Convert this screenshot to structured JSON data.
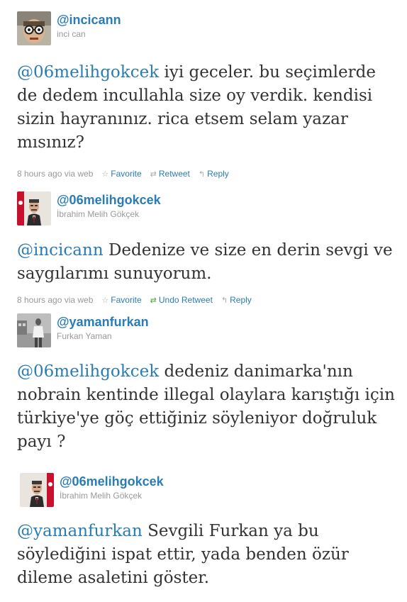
{
  "tweets": [
    {
      "handle": "@incicann",
      "name": "inci can",
      "mention": "@06melihgokcek",
      "body": " iyi geceler. bu seçimlerde de dedem incullahla size oy verdik. kendisi sizin hayranınız. rica etsem selam yazar mısınız?",
      "time": "8 hours ago via web",
      "favorite": "Favorite",
      "retweet": "Retweet",
      "reply": "Reply"
    },
    {
      "handle": "@06melihgokcek",
      "name": "İbrahim Melih Gökçek",
      "mention": "@incicann",
      "body": " Dedenize ve size en derin sevgi ve saygılarımı sunuyorum.",
      "time": "8 hours ago via web",
      "favorite": "Favorite",
      "retweet": "Undo Retweet",
      "reply": "Reply"
    },
    {
      "handle": "@yamanfurkan",
      "name": "Furkan Yaman",
      "mention": "@06melihgokcek",
      "body": " dedeniz danimarka'nın nobrain kentinde illegal olaylara karıştığı için türkiye'ye göç ettiğiniz söyleniyor doğruluk payı ?"
    },
    {
      "handle": "@06melihgokcek",
      "name": "İbrahim Melih Gökçek",
      "mention": "@yamanfurkan",
      "body": " Sevgili Furkan ya bu söylediğini ispat ettir, yada benden özür dileme asaletini göster."
    }
  ],
  "icons": {
    "favorite": "star-icon",
    "retweet": "retweet-icon",
    "reply": "reply-icon"
  },
  "colors": {
    "link": "#2a7cb4",
    "meta": "#999999",
    "text": "#333333",
    "retweet_active": "#5a9e3c"
  }
}
